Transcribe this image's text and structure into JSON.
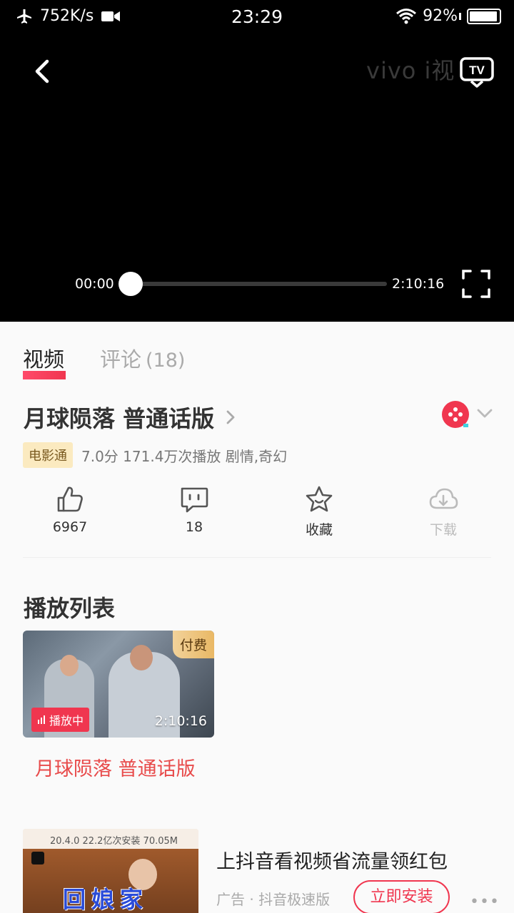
{
  "status_bar": {
    "speed": "752K/s",
    "time": "23:29",
    "battery": "92%"
  },
  "player": {
    "watermark": "vivo i视",
    "current_time": "00:00",
    "total_time": "2:10:16",
    "progress": 0
  },
  "tabs": {
    "video": "视频",
    "comments": "评论",
    "comments_count": "(18)"
  },
  "video": {
    "title": "月球陨落 普通话版",
    "badge": "电影通",
    "meta": "7.0分 171.4万次播放 剧情,奇幻"
  },
  "actions": {
    "like_count": "6967",
    "comment_count": "18",
    "favorite_label": "收藏",
    "download_label": "下载"
  },
  "playlist": {
    "heading": "播放列表",
    "items": [
      {
        "paid_tag": "付费",
        "playing_label": "播放中",
        "duration": "2:10:16",
        "title": "月球陨落 普通话版"
      }
    ]
  },
  "ad": {
    "thumb_top": "20.4.0   22.2亿次安装   70.05M",
    "thumb_text": "回娘家",
    "title": "上抖音看视频省流量领红包",
    "sub": "广告 · 抖音极速版",
    "install": "立即安装",
    "more": "•••"
  },
  "colors": {
    "accent": "#f0364f",
    "playlist_title": "#e84b4b",
    "badge_bg": "#fbeac0"
  }
}
